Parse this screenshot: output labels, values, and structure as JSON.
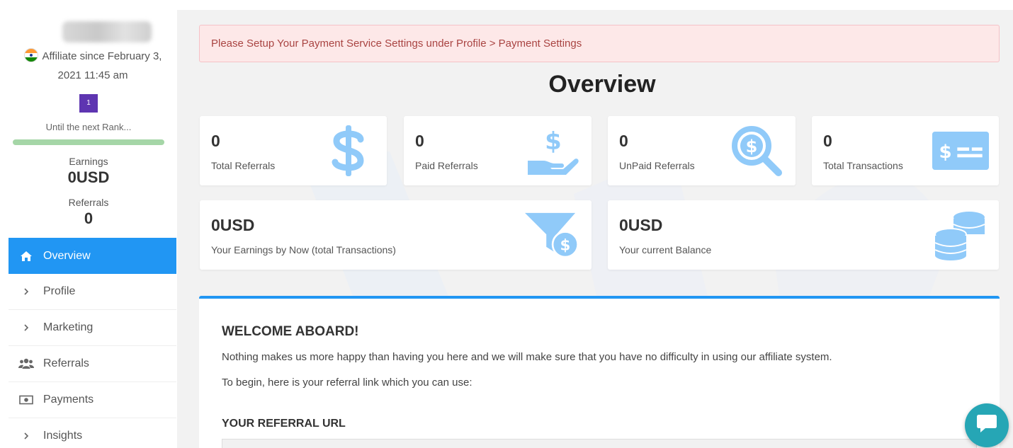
{
  "sidebar": {
    "affiliate_since": "Affiliate since February 3, 2021 11:45 am",
    "rank": "1",
    "next_rank_label": "Until the next Rank...",
    "earnings_label": "Earnings",
    "earnings_value": "0USD",
    "referrals_label": "Referrals",
    "referrals_value": "0",
    "nav": [
      {
        "label": "Overview",
        "icon": "home-icon",
        "active": true
      },
      {
        "label": "Profile",
        "icon": "chevron-right-icon"
      },
      {
        "label": "Marketing",
        "icon": "chevron-right-icon"
      },
      {
        "label": "Referrals",
        "icon": "users-icon"
      },
      {
        "label": "Payments",
        "icon": "money-bill-icon"
      },
      {
        "label": "Insights",
        "icon": "chevron-right-icon"
      }
    ]
  },
  "main": {
    "alert": "Please Setup Your Payment Service Settings under Profile > Payment Settings",
    "title": "Overview",
    "cards": [
      {
        "value": "0",
        "label": "Total Referrals",
        "icon": "dollar-sign-icon"
      },
      {
        "value": "0",
        "label": "Paid Referrals",
        "icon": "hand-holding-dollar-icon"
      },
      {
        "value": "0",
        "label": "UnPaid Referrals",
        "icon": "search-dollar-icon"
      },
      {
        "value": "0",
        "label": "Total Transactions",
        "icon": "money-check-icon"
      },
      {
        "value": "0USD",
        "label": "Your Earnings by Now (total Transactions)",
        "icon": "funnel-dollar-icon"
      },
      {
        "value": "0USD",
        "label": "Your current Balance",
        "icon": "coins-icon"
      }
    ],
    "welcome": {
      "heading": "WELCOME ABOARD!",
      "p1": "Nothing makes us more happy than having you here and we will make sure that you have no difficulty in using our affiliate system.",
      "p2": "To begin, here is your referral link which you can use:",
      "url_heading": "YOUR REFERRAL URL"
    }
  },
  "colors": {
    "accent": "#2196f3",
    "icon_blue": "#90caf9",
    "alert_bg": "#fde8e8",
    "alert_text": "#a94442",
    "rank_badge": "#5e35b1",
    "chat": "#26a6b5"
  }
}
